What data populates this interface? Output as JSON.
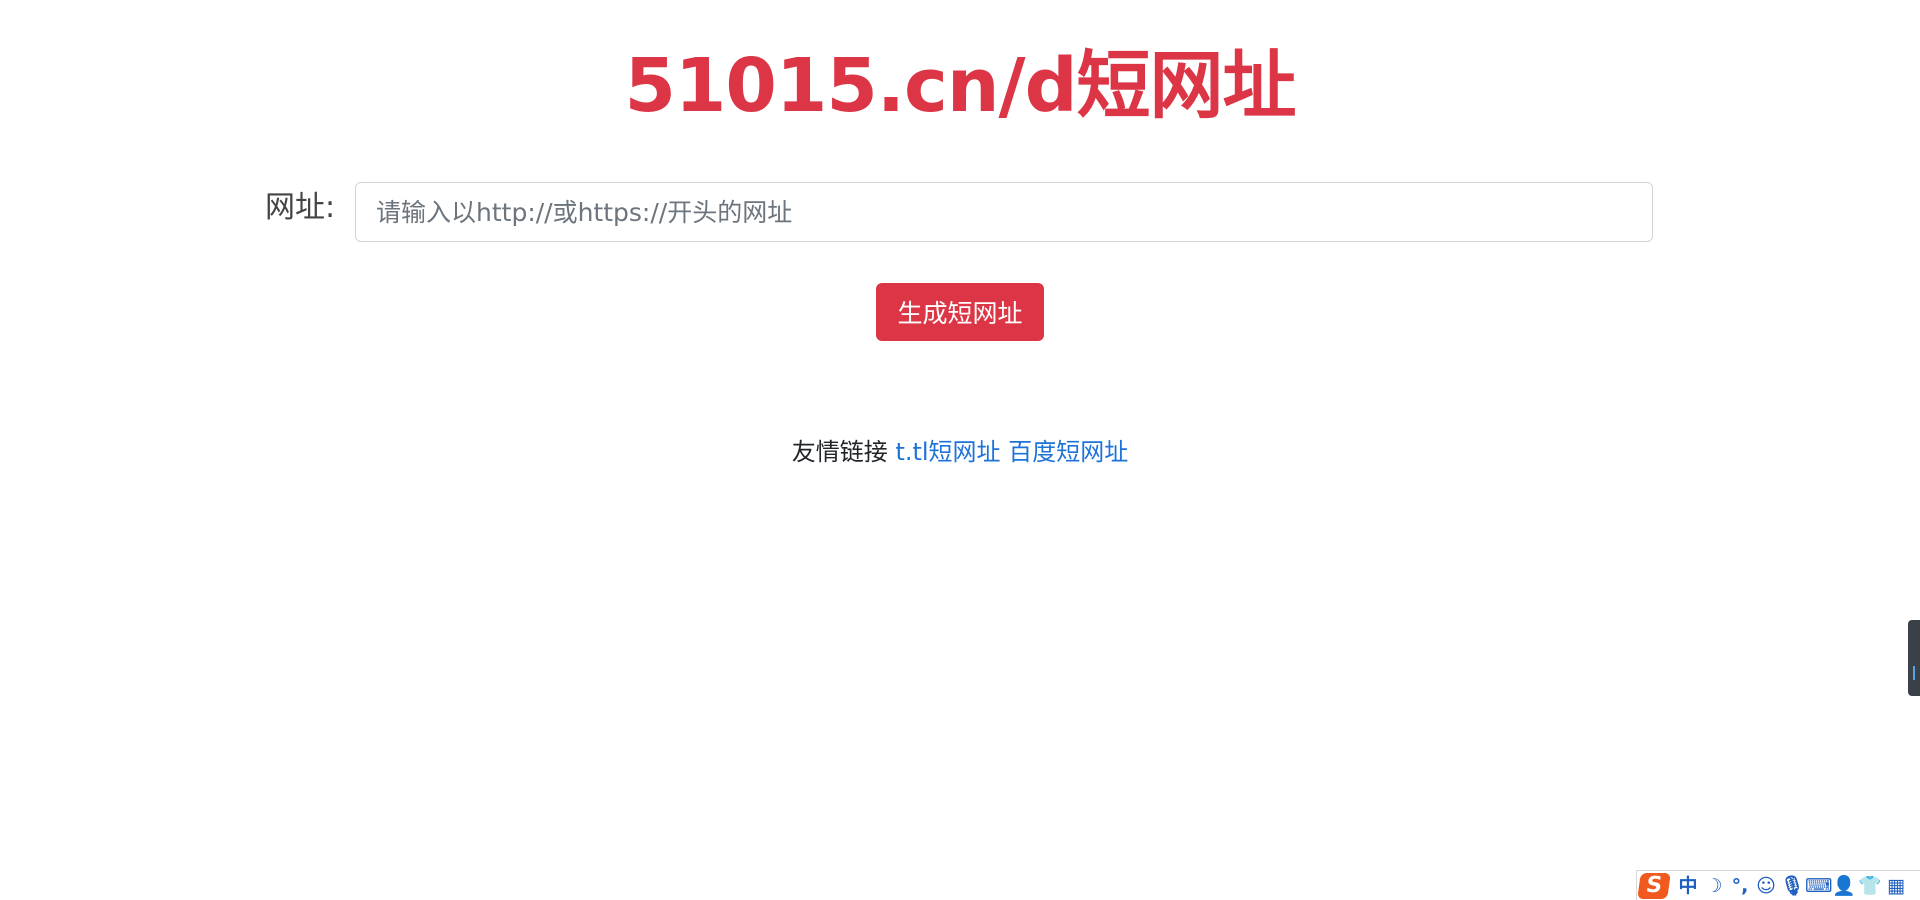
{
  "header": {
    "title": "51015.cn/d短网址"
  },
  "form": {
    "url_label": "网址:",
    "url_placeholder": "请输入以http://或https://开头的网址",
    "url_value": "",
    "submit_label": "生成短网址"
  },
  "footer": {
    "friend_links_label": "友情链接",
    "links": [
      {
        "label": "t.tl短网址"
      },
      {
        "label": "百度短网址"
      }
    ]
  },
  "ime_toolbar": {
    "logo": "S",
    "items": [
      {
        "name": "chinese-mode-icon",
        "glyph": "中"
      },
      {
        "name": "moon-icon",
        "glyph": "☽"
      },
      {
        "name": "punctuation-icon",
        "glyph": "°,"
      },
      {
        "name": "emoji-icon",
        "glyph": "☺"
      },
      {
        "name": "microphone-icon",
        "glyph": "🎙"
      },
      {
        "name": "keyboard-icon",
        "glyph": "⌨"
      },
      {
        "name": "user-icon",
        "glyph": "👤"
      },
      {
        "name": "skin-shirt-icon",
        "glyph": "👕"
      },
      {
        "name": "grid-menu-icon",
        "glyph": "▦"
      }
    ]
  },
  "colors": {
    "brand_red": "#dc3545",
    "link_blue": "#1e73d8"
  }
}
